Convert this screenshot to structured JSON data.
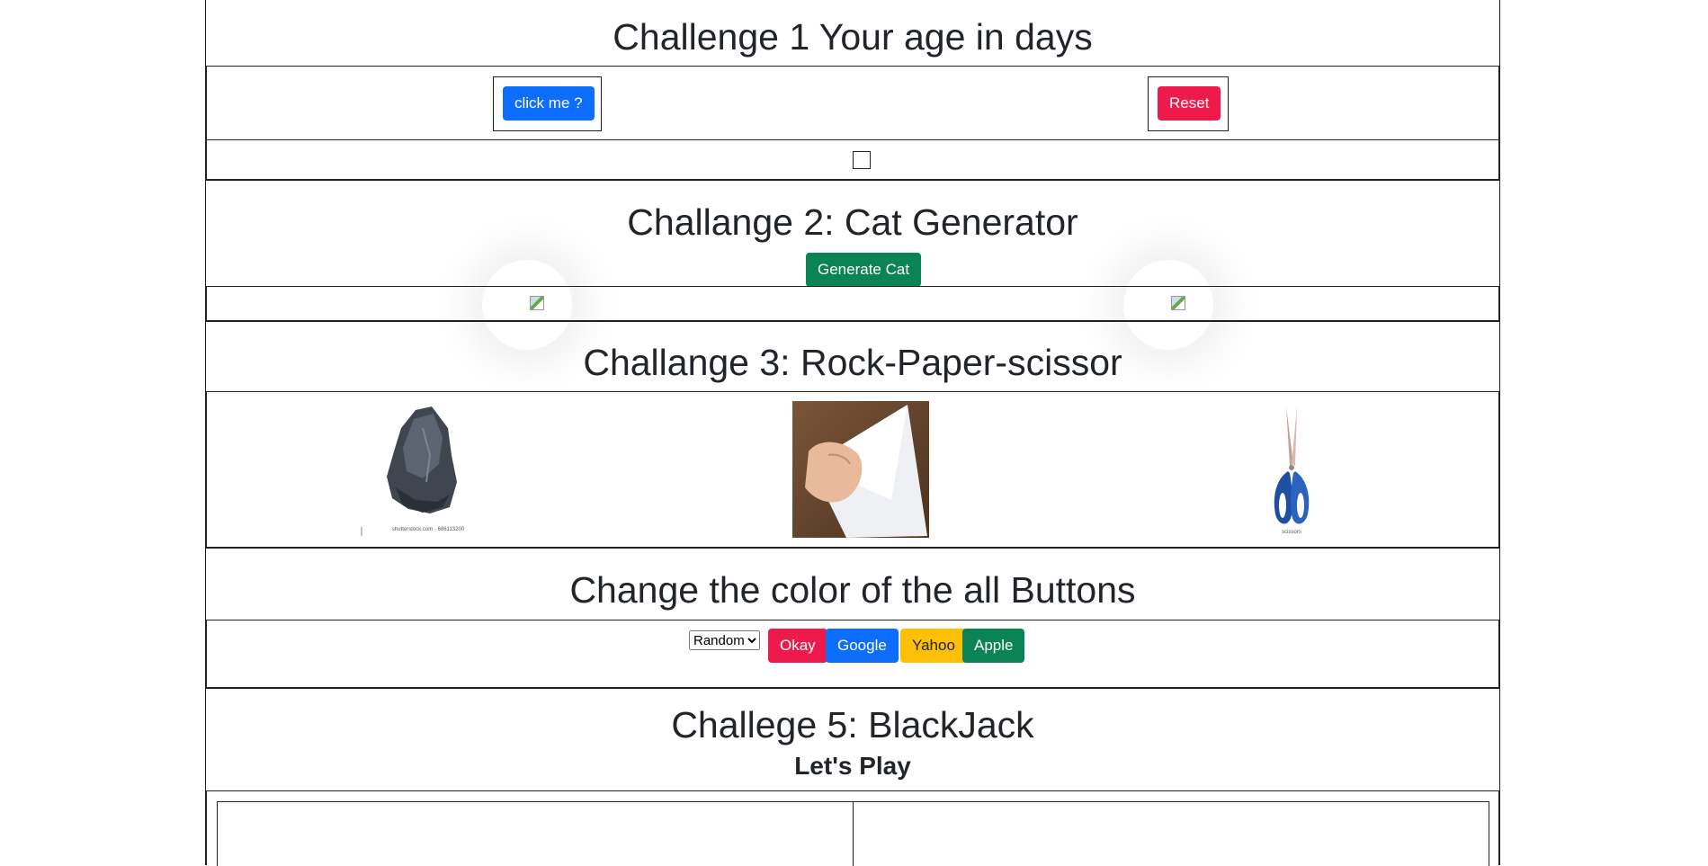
{
  "challenge1": {
    "title": "Challenge 1 Your age in days",
    "click_label": "click me ?",
    "reset_label": "Reset"
  },
  "challenge2": {
    "title": "Challange 2: Cat Generator",
    "generate_label": "Generate Cat"
  },
  "challenge3": {
    "title": "Challange 3: Rock-Paper-scissor",
    "rock_caption": "shutterstock.com · 686113200",
    "scissor_caption": "scissors"
  },
  "challenge4": {
    "title": "Change the color of the all Buttons",
    "select_value": "Random",
    "buttons": [
      "Okay",
      "Google",
      "Yahoo",
      "Apple"
    ]
  },
  "challenge5": {
    "title": "Challege 5: BlackJack",
    "subtitle": "Let's Play"
  },
  "colors": {
    "primary": "#0d6efd",
    "danger": "#ef1a4c",
    "success": "#0a8454",
    "warning": "#fec007"
  }
}
